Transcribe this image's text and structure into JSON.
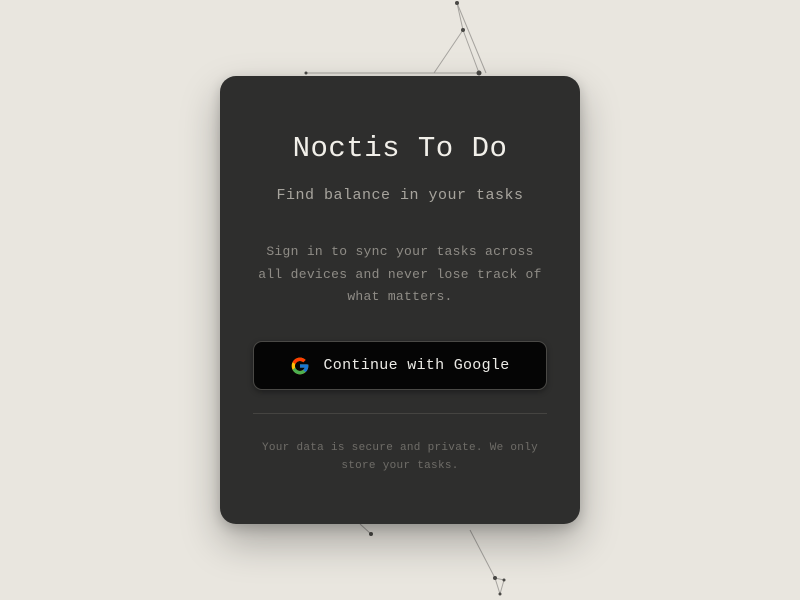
{
  "app": {
    "title": "Noctis To Do",
    "tagline": "Find balance in your tasks"
  },
  "login": {
    "description": "Sign in to sync your tasks across all devices and never lose track of what matters.",
    "google_button_label": "Continue with Google",
    "google_icon": "google-icon",
    "privacy_note": "Your data is secure and private. We only store your tasks."
  },
  "colors": {
    "page_background": "#e9e6df",
    "card_background": "#2e2e2d",
    "button_background": "#050505",
    "title_text": "#f1efe9",
    "google_blue": "#4285F4",
    "google_red": "#EA4335",
    "google_yellow": "#FBBC05",
    "google_green": "#34A853"
  }
}
